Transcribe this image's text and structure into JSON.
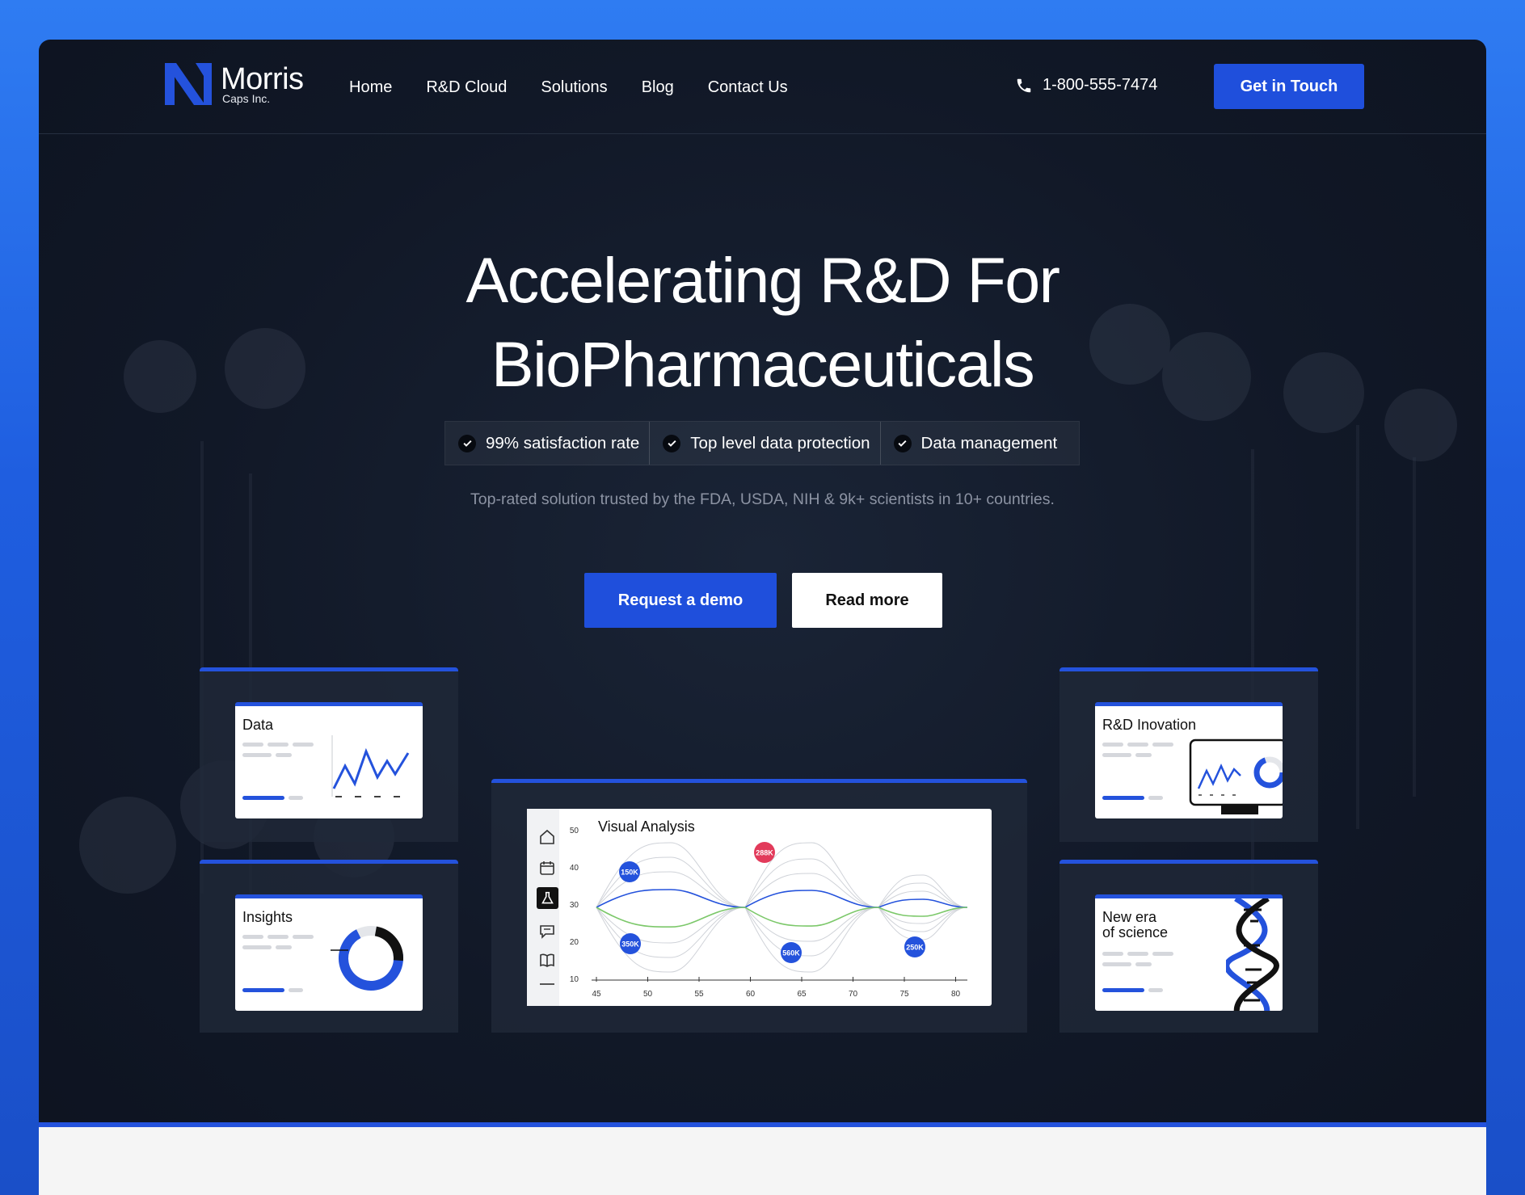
{
  "brand": {
    "name": "Morris",
    "subtitle": "Caps Inc.",
    "accent": "#1f4fdc"
  },
  "nav": {
    "items": [
      "Home",
      "R&D Cloud",
      "Solutions",
      "Blog",
      "Contact Us"
    ]
  },
  "contact": {
    "icon": "phone-icon",
    "phone": "1-800-555-7474",
    "cta": "Get in Touch"
  },
  "hero": {
    "title_line1": "Accelerating R&D For",
    "title_line2": "BioPharmaceuticals",
    "features": [
      "99% satisfaction rate",
      "Top level data protection",
      "Data management"
    ],
    "subtitle": "Top-rated solution trusted by the FDA, USDA, NIH & 9k+ scientists in 10+ countries.",
    "primary_button": "Request a demo",
    "secondary_button": "Read more"
  },
  "cards": {
    "data": "Data",
    "insights": "Insights",
    "rd": "R&D Inovation",
    "era_line1": "New era",
    "era_line2": "of science"
  },
  "visual_analysis": {
    "title": "Visual Analysis",
    "y_ticks": [
      "50",
      "40",
      "30",
      "20",
      "10"
    ],
    "x_ticks": [
      "45",
      "50",
      "55",
      "60",
      "65",
      "70",
      "75",
      "80"
    ],
    "badges": [
      {
        "label": "150K",
        "color": "#2452dc"
      },
      {
        "label": "350K",
        "color": "#2452dc"
      },
      {
        "label": "288K",
        "color": "#e23a5a"
      },
      {
        "label": "560K",
        "color": "#2452dc"
      },
      {
        "label": "250K",
        "color": "#2452dc"
      }
    ]
  }
}
